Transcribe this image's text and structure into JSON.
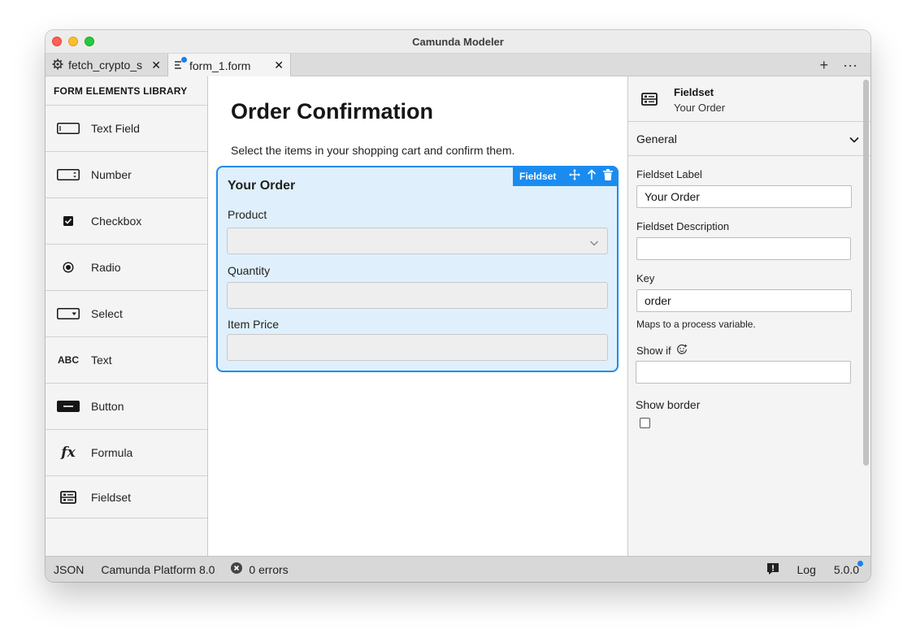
{
  "window": {
    "title": "Camunda Modeler"
  },
  "tabs": [
    {
      "label": "fetch_crypto_s",
      "icon": "gear-icon"
    },
    {
      "label": "form_1.form",
      "icon": "form-icon",
      "unsaved": true
    }
  ],
  "library": {
    "header": "FORM ELEMENTS LIBRARY",
    "items": [
      {
        "label": "Text Field",
        "icon": "textfield-icon"
      },
      {
        "label": "Number",
        "icon": "number-icon"
      },
      {
        "label": "Checkbox",
        "icon": "checkbox-icon"
      },
      {
        "label": "Radio",
        "icon": "radio-icon"
      },
      {
        "label": "Select",
        "icon": "select-icon"
      },
      {
        "label": "Text",
        "icon": "text-icon",
        "glyph": "ABC"
      },
      {
        "label": "Button",
        "icon": "button-icon"
      },
      {
        "label": "Formula",
        "icon": "formula-icon",
        "glyph": "fx"
      },
      {
        "label": "Fieldset",
        "icon": "fieldset-icon"
      }
    ]
  },
  "canvas": {
    "title": "Order Confirmation",
    "description": "Select the items in your shopping cart and confirm them.",
    "fieldset": {
      "toolbar_label": "Fieldset",
      "legend": "Your Order",
      "fields": [
        {
          "label": "Product",
          "type": "select"
        },
        {
          "label": "Quantity",
          "type": "number"
        },
        {
          "label": "Item Price",
          "type": "number"
        }
      ]
    }
  },
  "properties": {
    "type": "Fieldset",
    "subtitle": "Your Order",
    "group": "General",
    "fieldset_label": {
      "label": "Fieldset Label",
      "value": "Your Order"
    },
    "fieldset_description": {
      "label": "Fieldset Description",
      "value": ""
    },
    "key": {
      "label": "Key",
      "value": "order",
      "hint": "Maps to a process variable."
    },
    "show_if": {
      "label": "Show if",
      "value": ""
    },
    "show_border": {
      "label": "Show border",
      "checked": false
    }
  },
  "status": {
    "json": "JSON",
    "platform": "Camunda Platform 8.0",
    "errors": "0 errors",
    "log": "Log",
    "version": "5.0.0"
  },
  "colors": {
    "accent": "#1a8cf0",
    "fieldset_bg": "#dff0fc",
    "unsaved_dot": "#1a7ff0"
  }
}
